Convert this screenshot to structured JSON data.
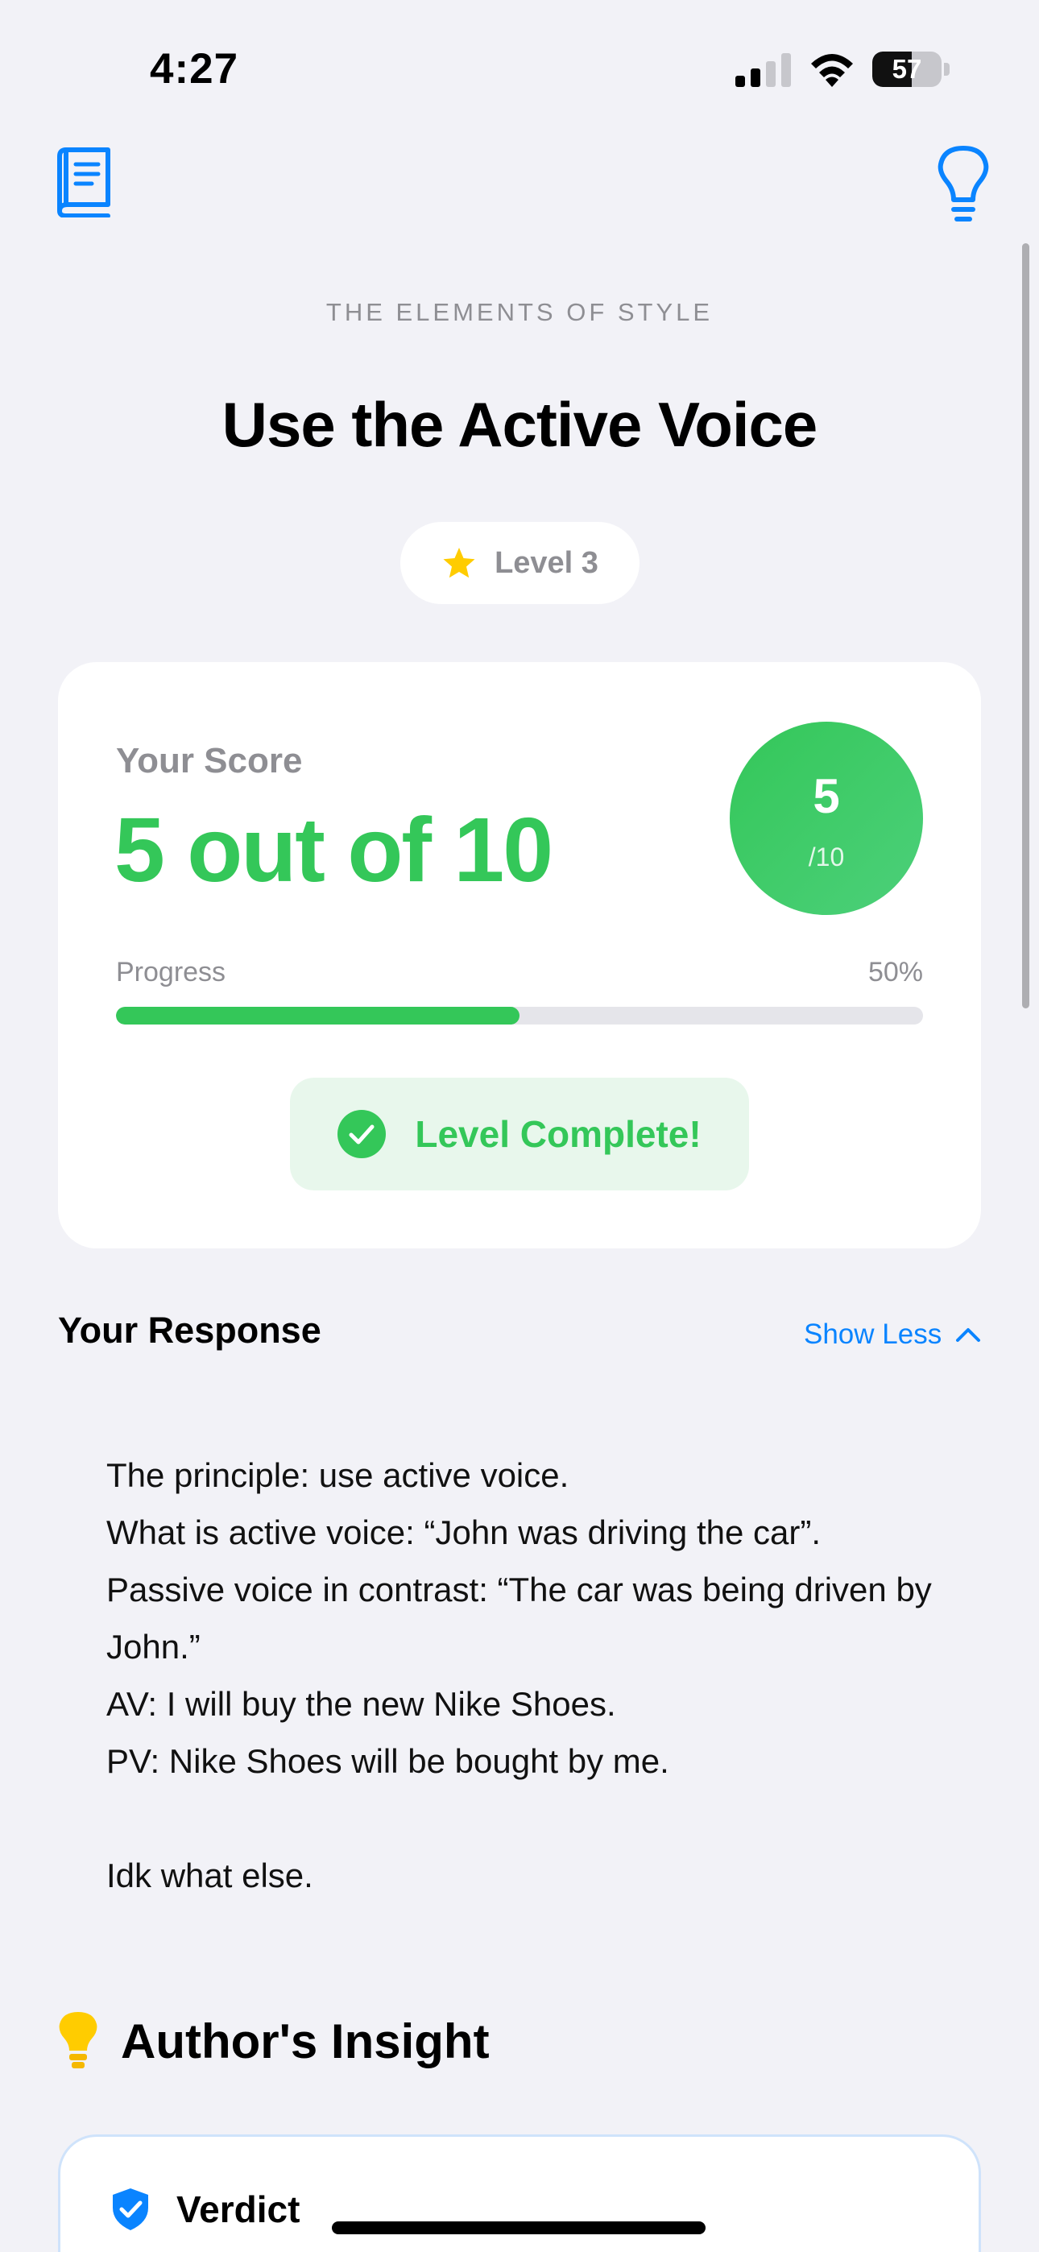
{
  "status_bar": {
    "time": "4:27",
    "battery_level": "57",
    "battery_fraction": 0.57
  },
  "nav": {
    "left_icon": "book-icon",
    "right_icon": "lightbulb-icon",
    "accent_color": "#0A84FF"
  },
  "header": {
    "eyebrow": "THE ELEMENTS OF STYLE",
    "title": "Use the Active Voice",
    "level_label": "Level 3",
    "level_icon": "star-icon"
  },
  "score_card": {
    "label": "Your Score",
    "value": "5 out of 10",
    "circle_score": "5",
    "circle_total": "/10",
    "progress_label": "Progress",
    "progress_percent": "50%",
    "progress_fraction": 0.5,
    "complete_label": "Level Complete!",
    "success_color": "#34C759"
  },
  "response": {
    "heading": "Your Response",
    "toggle_label": "Show Less",
    "lines": [
      "The principle: use active voice.",
      "What is active voice: “John was driving the car”.",
      "Passive voice in contrast: “The car was being driven by John.”",
      "AV: I will buy the new Nike Shoes.",
      "PV: Nike Shoes will be bought by me.",
      "",
      "Idk what else."
    ]
  },
  "insight": {
    "heading": "Author's Insight",
    "verdict_label": "Verdict"
  }
}
